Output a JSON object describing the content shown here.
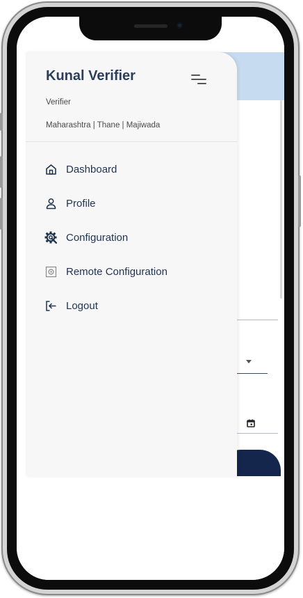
{
  "drawer": {
    "user_name": "Kunal Verifier",
    "role": "Verifier",
    "location": "Maharashtra | Thane | Majiwada",
    "menu_toggle_icon": "menu-collapse-icon",
    "items": [
      {
        "label": "Dashboard",
        "icon": "home-icon"
      },
      {
        "label": "Profile",
        "icon": "person-icon"
      },
      {
        "label": "Configuration",
        "icon": "settings-search-icon"
      },
      {
        "label": "Remote Configuration",
        "icon": "remote-config-icon"
      },
      {
        "label": "Logout",
        "icon": "logout-icon"
      }
    ]
  },
  "colors": {
    "header_accent": "#c7dbf0",
    "primary_button": "#14264b",
    "drawer_background": "#f7f7f7",
    "text_primary": "#1f3350"
  }
}
